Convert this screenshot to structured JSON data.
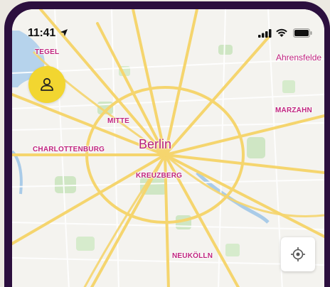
{
  "status_bar": {
    "time": "11:41",
    "location_icon": "location-arrow-icon",
    "signal_icon": "cellular-signal-icon",
    "wifi_icon": "wifi-icon",
    "battery_icon": "battery-icon"
  },
  "map": {
    "city": "Berlin",
    "districts": {
      "tegel": "TEGEL",
      "mitte": "MITTE",
      "charlottenburg": "CHARLOTTENBURG",
      "kreuzberg": "KREUZBERG",
      "marzahn": "MARZAHN",
      "neukoelln": "NEUKÖLLN"
    },
    "places": {
      "ahrensfelde": "Ahrensfelde"
    },
    "colors": {
      "road": "#f5d56e",
      "park": "#cfe6c4",
      "water": "#a9cbe8",
      "label": "#c0247f"
    }
  },
  "controls": {
    "profile_icon": "user-icon",
    "profile_color": "#f2d630",
    "locate_icon": "locate-crosshair-icon"
  },
  "frame": {
    "color": "#2c0f3e"
  }
}
